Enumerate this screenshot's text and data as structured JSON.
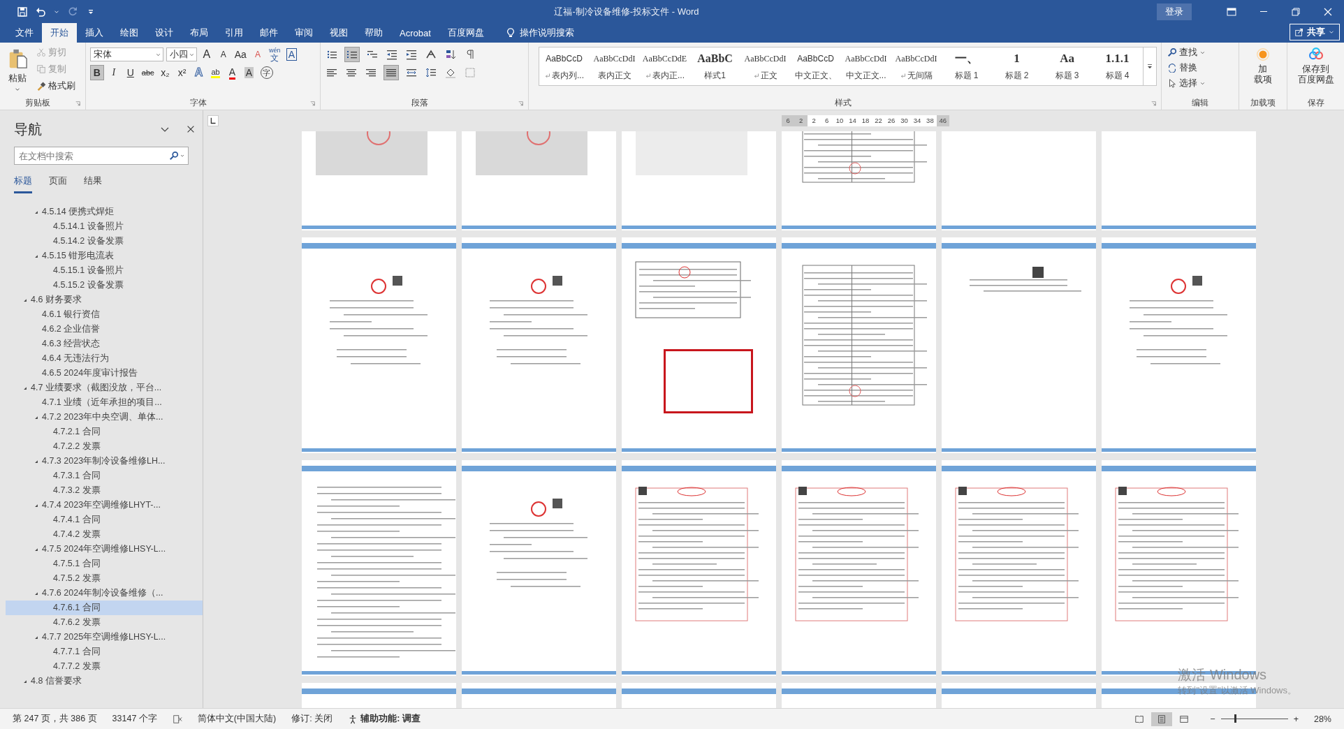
{
  "window": {
    "title": "辽福-制冷设备维修-投标文件  -  Word",
    "sign_in": "登录",
    "share": "共享"
  },
  "tabs": [
    {
      "label": "文件",
      "selected": false
    },
    {
      "label": "开始",
      "selected": true
    },
    {
      "label": "插入",
      "selected": false
    },
    {
      "label": "绘图",
      "selected": false
    },
    {
      "label": "设计",
      "selected": false
    },
    {
      "label": "布局",
      "selected": false
    },
    {
      "label": "引用",
      "selected": false
    },
    {
      "label": "邮件",
      "selected": false
    },
    {
      "label": "审阅",
      "selected": false
    },
    {
      "label": "视图",
      "selected": false
    },
    {
      "label": "帮助",
      "selected": false
    },
    {
      "label": "Acrobat",
      "selected": false
    },
    {
      "label": "百度网盘",
      "selected": false
    }
  ],
  "tell_me": "操作说明搜索",
  "clipboard": {
    "label": "剪贴板",
    "paste": "粘贴",
    "items": [
      {
        "label": "剪切",
        "kind": "scissors",
        "disabled": true
      },
      {
        "label": "复制",
        "kind": "copy",
        "disabled": true
      },
      {
        "label": "格式刷",
        "kind": "brush",
        "disabled": false
      }
    ]
  },
  "font": {
    "label": "字体",
    "name": "宋体",
    "size": "小四",
    "row1": [
      {
        "glyph": "A",
        "kind": "grow",
        "pressed": false
      },
      {
        "glyph": "A",
        "kind": "shrink",
        "pressed": false
      },
      {
        "glyph": "Aa",
        "kind": "case",
        "pressed": false
      },
      {
        "glyph": "A",
        "kind": "eraser",
        "pressed": false
      },
      {
        "glyph": "文",
        "ruby": "wén",
        "kind": "ruby",
        "pressed": false
      },
      {
        "glyph": "A",
        "kind": "boxed",
        "pressed": false
      }
    ],
    "row2": [
      {
        "glyph": "B",
        "kind": "bold",
        "pressed": true
      },
      {
        "glyph": "I",
        "kind": "italic",
        "pressed": false
      },
      {
        "glyph": "U",
        "kind": "underline",
        "pressed": false
      },
      {
        "glyph": "abc",
        "kind": "strike",
        "pressed": false
      },
      {
        "glyph": "x₂",
        "kind": "plain",
        "pressed": false
      },
      {
        "glyph": "x²",
        "kind": "plain",
        "pressed": false
      },
      {
        "glyph": "A",
        "kind": "effect",
        "pressed": false
      },
      {
        "glyph": "ab",
        "kind": "highlight",
        "pressed": false
      },
      {
        "glyph": "A",
        "kind": "color",
        "pressed": false
      },
      {
        "glyph": "A",
        "kind": "shade",
        "pressed": false
      },
      {
        "glyph": "字",
        "kind": "circle",
        "pressed": false
      }
    ]
  },
  "paragraph": {
    "label": "段落",
    "row1": [
      {
        "kind": "bullets",
        "pressed": false
      },
      {
        "kind": "numbering",
        "pressed": true
      },
      {
        "kind": "multilevel",
        "pressed": false
      },
      {
        "kind": "outdent",
        "pressed": false
      },
      {
        "kind": "indent",
        "pressed": false
      },
      {
        "kind": "asian",
        "pressed": false
      },
      {
        "kind": "sort",
        "pressed": false
      },
      {
        "kind": "marks",
        "pressed": false
      }
    ],
    "row2": [
      {
        "kind": "left",
        "pressed": false
      },
      {
        "kind": "center",
        "pressed": false
      },
      {
        "kind": "right",
        "pressed": false
      },
      {
        "kind": "justify",
        "pressed": true
      },
      {
        "kind": "distributed",
        "pressed": false
      },
      {
        "kind": "spacing",
        "pressed": false
      },
      {
        "kind": "fill",
        "pressed": false
      },
      {
        "kind": "borders",
        "pressed": false
      }
    ]
  },
  "styles": {
    "label": "样式",
    "items": [
      {
        "preview": "AaBbCcD",
        "name": "表内列...",
        "kind": "normal",
        "linked": true
      },
      {
        "preview": "AaBbCcDdI",
        "name": "表内正文",
        "kind": "serif",
        "linked": false
      },
      {
        "preview": "AaBbCcDdE",
        "name": "表内正...",
        "kind": "serif",
        "linked": true
      },
      {
        "preview": "AaBbC",
        "name": "样式1",
        "kind": "bold",
        "linked": false
      },
      {
        "preview": "AaBbCcDdI",
        "name": "正文",
        "kind": "serif",
        "linked": true
      },
      {
        "preview": "AaBbCcD",
        "name": "中文正文、",
        "kind": "normal",
        "linked": false
      },
      {
        "preview": "AaBbCcDdI",
        "name": "中文正文...",
        "kind": "serif",
        "linked": false
      },
      {
        "preview": "AaBbCcDdI",
        "name": "无间隔",
        "kind": "serif",
        "linked": true
      },
      {
        "preview": "一、",
        "name": "标题 1",
        "kind": "heading",
        "linked": false
      },
      {
        "preview": "1",
        "name": "标题 2",
        "kind": "heading",
        "linked": false
      },
      {
        "preview": "Aa",
        "name": "标题 3",
        "kind": "heading",
        "linked": false
      },
      {
        "preview": "1.1.1",
        "name": "标题 4",
        "kind": "heading",
        "linked": false
      }
    ]
  },
  "editing": {
    "label": "编辑",
    "items": [
      {
        "label": "查找",
        "kind": "search",
        "dropdown": true
      },
      {
        "label": "替换",
        "kind": "replace",
        "dropdown": false
      },
      {
        "label": "选择",
        "kind": "cursor",
        "dropdown": true
      }
    ]
  },
  "addins": {
    "label": "加载项",
    "button": [
      "加",
      "载项"
    ]
  },
  "save": {
    "label": "保存",
    "button": [
      "保存到",
      "百度网盘"
    ]
  },
  "navigation": {
    "title": "导航",
    "search": {
      "placeholder": "在文档中搜索"
    },
    "tabs": [
      {
        "label": "标题",
        "selected": true
      },
      {
        "label": "页面",
        "selected": false
      },
      {
        "label": "结果",
        "selected": false
      }
    ],
    "continued": [
      {
        "label": "4.5.14 便携式焊炬",
        "expanded": true,
        "selected": false,
        "children": [
          {
            "label": "4.5.14.1 设备照片",
            "selected": false
          },
          {
            "label": "4.5.14.2 设备发票",
            "selected": false
          }
        ]
      },
      {
        "label": "4.5.15 钳形电流表",
        "expanded": true,
        "selected": false,
        "children": [
          {
            "label": "4.5.15.1 设备照片",
            "selected": false
          },
          {
            "label": "4.5.15.2 设备发票",
            "selected": false
          }
        ]
      }
    ],
    "items": [
      {
        "label": "4.6 财务要求",
        "expanded": true,
        "selected": false,
        "children": [
          {
            "label": "4.6.1 银行资信",
            "selected": false
          },
          {
            "label": "4.6.2 企业信誉",
            "selected": false
          },
          {
            "label": "4.6.3 经营状态",
            "selected": false
          },
          {
            "label": "4.6.4 无违法行为",
            "selected": false
          },
          {
            "label": "4.6.5 2024年度审计报告",
            "selected": false
          }
        ]
      },
      {
        "label": "4.7 业绩要求（截图没放，平台...",
        "expanded": true,
        "selected": false,
        "children": [
          {
            "label": "4.7.1 业绩（近年承担的项目...",
            "selected": false
          },
          {
            "label": "4.7.2 2023年中央空调、单体...",
            "expanded": true,
            "selected": false,
            "children": [
              {
                "label": "4.7.2.1 合同",
                "selected": false
              },
              {
                "label": "4.7.2.2 发票",
                "selected": false
              }
            ]
          },
          {
            "label": "4.7.3 2023年制冷设备维修LH...",
            "expanded": true,
            "selected": false,
            "children": [
              {
                "label": "4.7.3.1 合同",
                "selected": false
              },
              {
                "label": "4.7.3.2 发票",
                "selected": false
              }
            ]
          },
          {
            "label": "4.7.4 2023年空调维修LHYT-...",
            "expanded": true,
            "selected": false,
            "children": [
              {
                "label": "4.7.4.1 合同",
                "selected": false
              },
              {
                "label": "4.7.4.2 发票",
                "selected": false
              }
            ]
          },
          {
            "label": "4.7.5 2024年空调维修LHSY-L...",
            "expanded": true,
            "selected": false,
            "children": [
              {
                "label": "4.7.5.1 合同",
                "selected": false
              },
              {
                "label": "4.7.5.2 发票",
                "selected": false
              }
            ]
          },
          {
            "label": "4.7.6 2024年制冷设备维修（...",
            "expanded": true,
            "selected": false,
            "children": [
              {
                "label": "4.7.6.1 合同",
                "selected": true
              },
              {
                "label": "4.7.6.2 发票",
                "selected": false
              }
            ]
          },
          {
            "label": "4.7.7 2025年空调维修LHSY-L...",
            "expanded": true,
            "selected": false,
            "children": [
              {
                "label": "4.7.7.1 合同",
                "selected": false
              },
              {
                "label": "4.7.7.2 发票",
                "selected": false
              }
            ]
          }
        ]
      },
      {
        "label": "4.8 信誉要求",
        "expanded": true,
        "selected": false
      }
    ]
  },
  "ruler": {
    "labels": [
      "6",
      "2",
      "2",
      "6",
      "10",
      "14",
      "18",
      "22",
      "26",
      "30",
      "34",
      "38",
      "46"
    ]
  },
  "pages": [
    {
      "kind": "photo",
      "marked": false
    },
    {
      "kind": "photo",
      "marked": false
    },
    {
      "kind": "blank",
      "marked": false
    },
    {
      "kind": "table",
      "marked": false
    },
    {
      "kind": "sparse",
      "marked": false
    },
    {
      "kind": "sparse",
      "marked": false
    },
    {
      "kind": "contract",
      "marked": false
    },
    {
      "kind": "contract",
      "marked": false
    },
    {
      "kind": "scan",
      "marked": true
    },
    {
      "kind": "table",
      "marked": false
    },
    {
      "kind": "sparse",
      "marked": false
    },
    {
      "kind": "contract",
      "marked": false
    },
    {
      "kind": "text",
      "marked": false
    },
    {
      "kind": "contract",
      "marked": false
    },
    {
      "kind": "invoice",
      "marked": false
    },
    {
      "kind": "invoice",
      "marked": false
    },
    {
      "kind": "invoice",
      "marked": false
    },
    {
      "kind": "invoice",
      "marked": false
    },
    {
      "kind": "text"
    },
    {
      "kind": "text"
    },
    {
      "kind": "text"
    },
    {
      "kind": "text"
    },
    {
      "kind": "text"
    },
    {
      "kind": "text"
    }
  ],
  "activation": {
    "title": "激活 Windows",
    "hint": "转到\"设置\"以激活 Windows。"
  },
  "status_bar": {
    "page": "第 247 页，共 386 页",
    "words": "33147 个字",
    "language": "简体中文(中国大陆)",
    "track_changes": "修订: 关闭",
    "accessibility": "辅助功能: 调查",
    "views": [
      {
        "kind": "read",
        "selected": false
      },
      {
        "kind": "print",
        "selected": true
      },
      {
        "kind": "web",
        "selected": false
      }
    ],
    "zoom_out": "−",
    "zoom_in": "+",
    "zoom": {
      "level": 0.2
    },
    "zoom_reading": "28%"
  }
}
